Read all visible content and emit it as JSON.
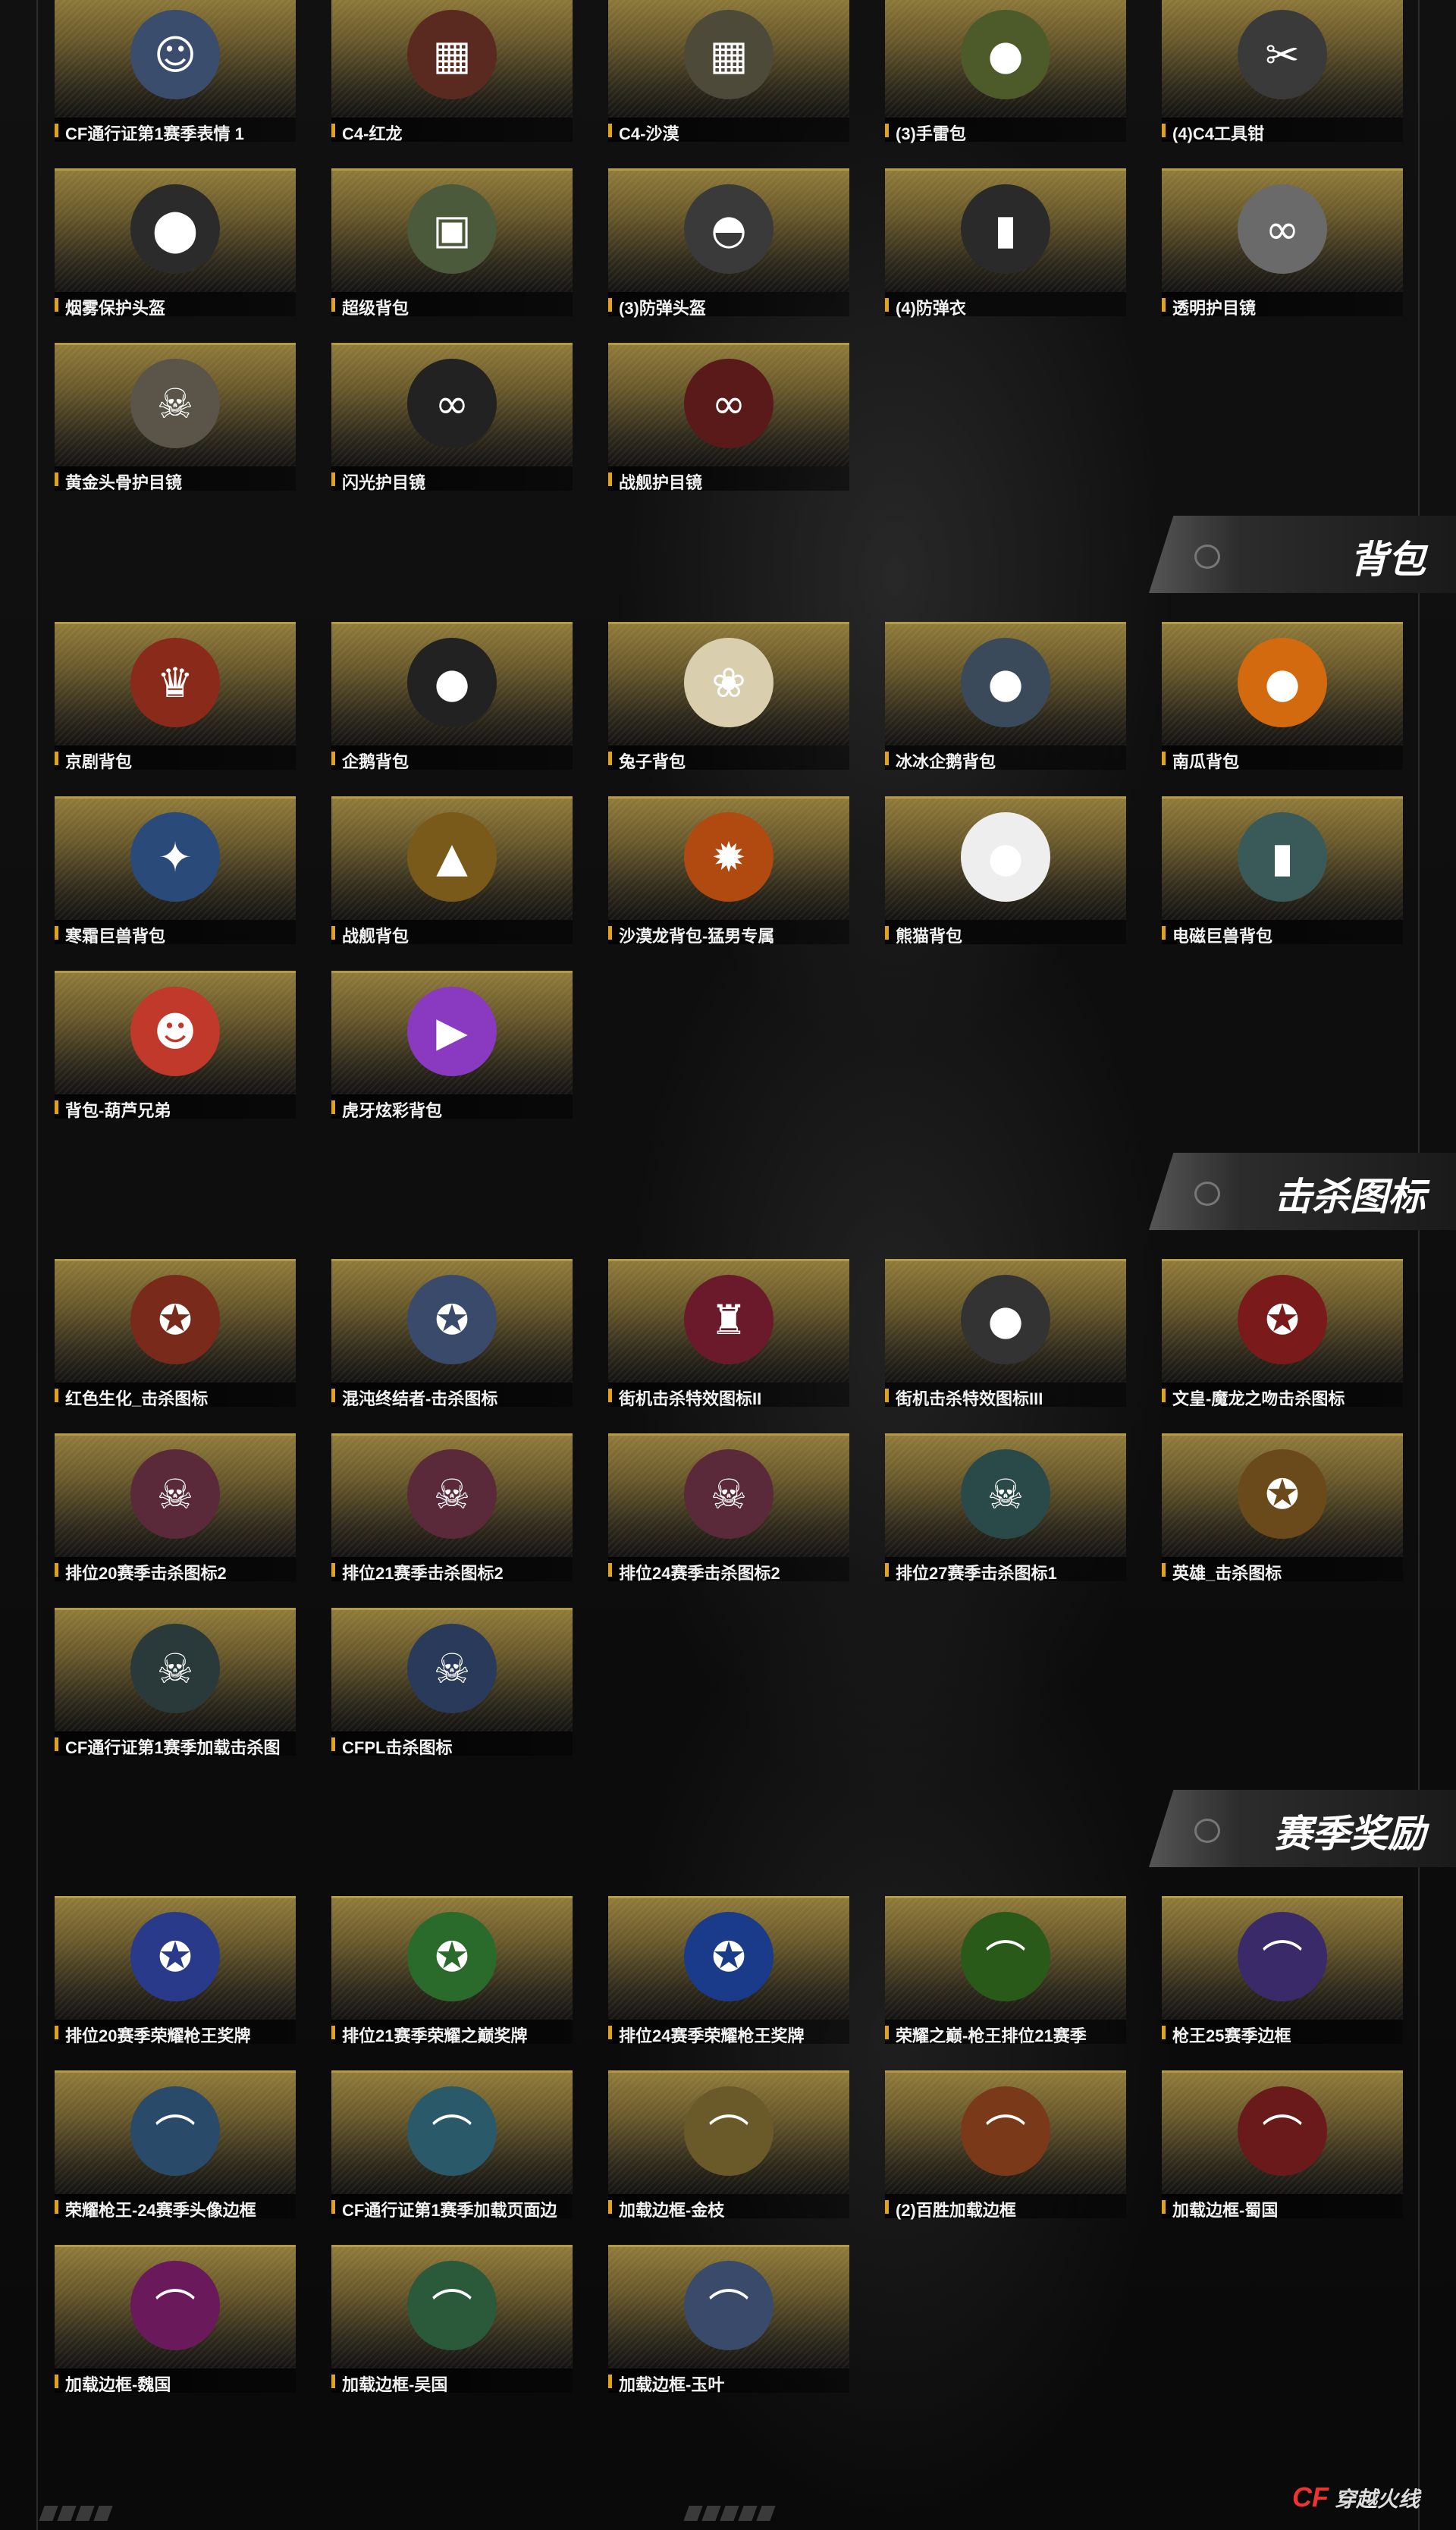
{
  "sections": [
    {
      "title": "",
      "items": [
        {
          "label": "CF通行证第1赛季表情 1",
          "icon": "emote-icon",
          "glyph": "☺",
          "color": "#3a4d6d"
        },
        {
          "label": "C4-红龙",
          "icon": "c4-bomb-icon",
          "glyph": "▦",
          "color": "#5a2a20"
        },
        {
          "label": "C4-沙漠",
          "icon": "c4-bomb-icon",
          "glyph": "▦",
          "color": "#4d4a3a"
        },
        {
          "label": "(3)手雷包",
          "icon": "grenade-icon",
          "glyph": "●",
          "color": "#4d5a2a"
        },
        {
          "label": "(4)C4工具钳",
          "icon": "plier-icon",
          "glyph": "✂",
          "color": "#3a3a3a"
        },
        {
          "label": "烟雾保护头盔",
          "icon": "helmet-icon",
          "glyph": "⬤",
          "color": "#2b2b2b"
        },
        {
          "label": "超级背包",
          "icon": "backpack-icon",
          "glyph": "▣",
          "color": "#4a5a3a"
        },
        {
          "label": "(3)防弹头盔",
          "icon": "helmet-icon",
          "glyph": "◓",
          "color": "#3a3a3a"
        },
        {
          "label": "(4)防弹衣",
          "icon": "vest-icon",
          "glyph": "▮",
          "color": "#2a2a2a"
        },
        {
          "label": "透明护目镜",
          "icon": "goggles-icon",
          "glyph": "∞",
          "color": "#6a6a6a"
        },
        {
          "label": "黄金头骨护目镜",
          "icon": "skull-mask-icon",
          "glyph": "☠",
          "color": "#5a5548"
        },
        {
          "label": "闪光护目镜",
          "icon": "goggles-icon",
          "glyph": "∞",
          "color": "#222"
        },
        {
          "label": "战舰护目镜",
          "icon": "goggles-icon",
          "glyph": "∞",
          "color": "#5a1a1a"
        }
      ]
    },
    {
      "title": "背包",
      "items": [
        {
          "label": "京剧背包",
          "icon": "opera-backpack-icon",
          "glyph": "♛",
          "color": "#8a2a1a"
        },
        {
          "label": "企鹅背包",
          "icon": "penguin-icon",
          "glyph": "●",
          "color": "#222"
        },
        {
          "label": "兔子背包",
          "icon": "rabbit-icon",
          "glyph": "❀",
          "color": "#d9cfae"
        },
        {
          "label": "冰冰企鹅背包",
          "icon": "penguin-icon",
          "glyph": "●",
          "color": "#3a4a5a"
        },
        {
          "label": "南瓜背包",
          "icon": "pumpkin-icon",
          "glyph": "●",
          "color": "#d46a10"
        },
        {
          "label": "寒霜巨兽背包",
          "icon": "frost-beast-icon",
          "glyph": "✦",
          "color": "#2a4a7a"
        },
        {
          "label": "战舰背包",
          "icon": "battleship-backpack-icon",
          "glyph": "▲",
          "color": "#7a5a1a"
        },
        {
          "label": "沙漠龙背包-猛男专属",
          "icon": "dragon-icon",
          "glyph": "✹",
          "color": "#b04a10"
        },
        {
          "label": "熊猫背包",
          "icon": "panda-icon",
          "glyph": "●",
          "color": "#eee"
        },
        {
          "label": "电磁巨兽背包",
          "icon": "robot-backpack-icon",
          "glyph": "▮",
          "color": "#3a5a5a"
        },
        {
          "label": "背包-葫芦兄弟",
          "icon": "gourd-boy-icon",
          "glyph": "☻",
          "color": "#c0392b"
        },
        {
          "label": "虎牙炫彩背包",
          "icon": "huya-backpack-icon",
          "glyph": "▶",
          "color": "#8a3ac0"
        }
      ]
    },
    {
      "title": "击杀图标",
      "items": [
        {
          "label": "红色生化_击杀图标",
          "icon": "kill-badge-icon",
          "glyph": "✪",
          "color": "#7a2a1a"
        },
        {
          "label": "混沌终结者-击杀图标",
          "icon": "kill-badge-icon",
          "glyph": "✪",
          "color": "#3a4a6a"
        },
        {
          "label": "街机击杀特效图标II",
          "icon": "pixel-robot-icon",
          "glyph": "♜",
          "color": "#6a1a2a"
        },
        {
          "label": "街机击杀特效图标III",
          "icon": "bomb-icon",
          "glyph": "●",
          "color": "#333"
        },
        {
          "label": "文皇-魔龙之吻击杀图标",
          "icon": "kill-badge-icon",
          "glyph": "✪",
          "color": "#7a1a1a"
        },
        {
          "label": "排位20赛季击杀图标2",
          "icon": "skull-badge-icon",
          "glyph": "☠",
          "color": "#5a2a3a"
        },
        {
          "label": "排位21赛季击杀图标2",
          "icon": "skull-badge-icon",
          "glyph": "☠",
          "color": "#5a2a3a"
        },
        {
          "label": "排位24赛季击杀图标2",
          "icon": "skull-badge-icon",
          "glyph": "☠",
          "color": "#5a2a3a"
        },
        {
          "label": "排位27赛季击杀图标1",
          "icon": "skull-badge-icon",
          "glyph": "☠",
          "color": "#2a4a4a"
        },
        {
          "label": "英雄_击杀图标",
          "icon": "hero-badge-icon",
          "glyph": "✪",
          "color": "#6a4a1a"
        },
        {
          "label": "CF通行证第1赛季加载击杀图",
          "icon": "skull-badge-icon",
          "glyph": "☠",
          "color": "#2a3a3a"
        },
        {
          "label": "CFPL击杀图标",
          "icon": "skull-badge-icon",
          "glyph": "☠",
          "color": "#2a3a5a"
        }
      ]
    },
    {
      "title": "赛季奖励",
      "items": [
        {
          "label": "排位20赛季荣耀枪王奖牌",
          "icon": "medal-icon",
          "glyph": "✪",
          "color": "#2a3a8a"
        },
        {
          "label": "排位21赛季荣耀之巅奖牌",
          "icon": "medal-icon",
          "glyph": "✪",
          "color": "#2a6a2a"
        },
        {
          "label": "排位24赛季荣耀枪王奖牌",
          "icon": "medal-icon",
          "glyph": "✪",
          "color": "#1a3a8a"
        },
        {
          "label": "荣耀之巅-枪王排位21赛季",
          "icon": "wing-frame-icon",
          "glyph": "⌒",
          "color": "#2a5a1a"
        },
        {
          "label": "枪王25赛季边框",
          "icon": "frame-icon",
          "glyph": "⌒",
          "color": "#3a2a6a"
        },
        {
          "label": "荣耀枪王-24赛季头像边框",
          "icon": "wing-frame-icon",
          "glyph": "⌒",
          "color": "#2a4a6a"
        },
        {
          "label": "CF通行证第1赛季加载页面边",
          "icon": "frame-icon",
          "glyph": "⌒",
          "color": "#2a5a6a"
        },
        {
          "label": "加载边框-金枝",
          "icon": "frame-icon",
          "glyph": "⌒",
          "color": "#6a5a2a"
        },
        {
          "label": "(2)百胜加载边框",
          "icon": "frame-icon",
          "glyph": "⌒",
          "color": "#7a3a1a"
        },
        {
          "label": "加载边框-蜀国",
          "icon": "frame-icon",
          "glyph": "⌒",
          "color": "#6a1a1a"
        },
        {
          "label": "加载边框-魏国",
          "icon": "frame-icon",
          "glyph": "⌒",
          "color": "#6a1a5a"
        },
        {
          "label": "加载边框-吴国",
          "icon": "frame-icon",
          "glyph": "⌒",
          "color": "#2a5a3a"
        },
        {
          "label": "加载边框-玉叶",
          "icon": "frame-icon",
          "glyph": "⌒",
          "color": "#3a4a6a"
        }
      ]
    }
  ],
  "footer": {
    "logo_mark": "CF",
    "logo_text": "穿越火线"
  }
}
